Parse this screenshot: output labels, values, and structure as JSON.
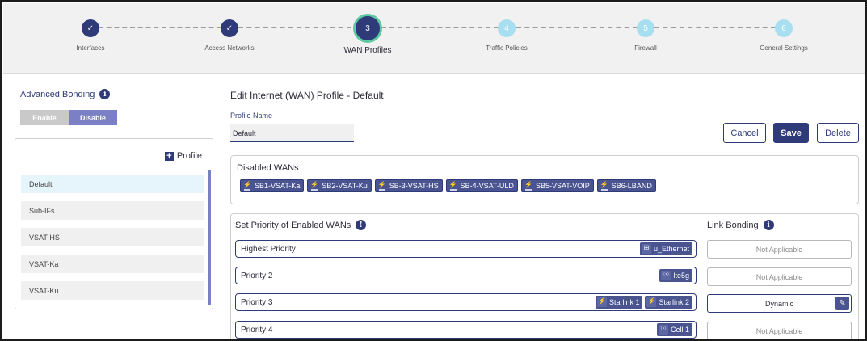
{
  "stepper": {
    "steps": [
      {
        "number": "1",
        "label": "Interfaces",
        "status": "done"
      },
      {
        "number": "2",
        "label": "Access Networks",
        "status": "done"
      },
      {
        "number": "3",
        "label": "WAN Profiles",
        "status": "active"
      },
      {
        "number": "4",
        "label": "Traffic Policies",
        "status": "pending"
      },
      {
        "number": "5",
        "label": "Firewall",
        "status": "pending"
      },
      {
        "number": "6",
        "label": "General Settings",
        "status": "pending"
      }
    ],
    "check_glyph": "✓"
  },
  "advanced_bonding": {
    "title": "Advanced Bonding",
    "info_glyph": "i",
    "enable_label": "Enable",
    "disable_label": "Disable",
    "selected": "Disable"
  },
  "profiles": {
    "add_label": "Profile",
    "items": [
      "Default",
      "Sub-IFs",
      "VSAT-HS",
      "VSAT-Ka",
      "VSAT-Ku"
    ],
    "selected": "Default"
  },
  "edit": {
    "title": "Edit Internet (WAN) Profile - Default",
    "profile_name_label": "Profile Name",
    "profile_name_value": "Default",
    "cancel_label": "Cancel",
    "save_label": "Save",
    "delete_label": "Delete"
  },
  "disabled_wans": {
    "title": "Disabled WANs",
    "items": [
      "SB1-VSAT-Ka",
      "SB2-VSAT-Ku",
      "SB-3-VSAT-HS",
      "SB-4-VSAT-ULD",
      "SB5-VSAT-VOIP",
      "SB6-LBAND"
    ]
  },
  "priority": {
    "title": "Set Priority of Enabled WANs",
    "alert_glyph": "!",
    "link_bonding_title": "Link Bonding",
    "rows": [
      {
        "label": "Highest Priority",
        "wans": [
          "u_Ethernet"
        ],
        "bonding": "Not Applicable"
      },
      {
        "label": "Priority 2",
        "wans": [
          "lte5g"
        ],
        "bonding": "Not Applicable"
      },
      {
        "label": "Priority 3",
        "wans": [
          "Starlink 1",
          "Starlink 2"
        ],
        "bonding": "Dynamic"
      },
      {
        "label": "Priority 4",
        "wans": [
          "Cell 1"
        ],
        "bonding": "Not Applicable"
      }
    ]
  },
  "colors": {
    "primary": "#2e3b78",
    "accent_ring": "#5cc9a0",
    "pending_step": "#a8dff0",
    "selected_row": "#e6f4fb"
  }
}
